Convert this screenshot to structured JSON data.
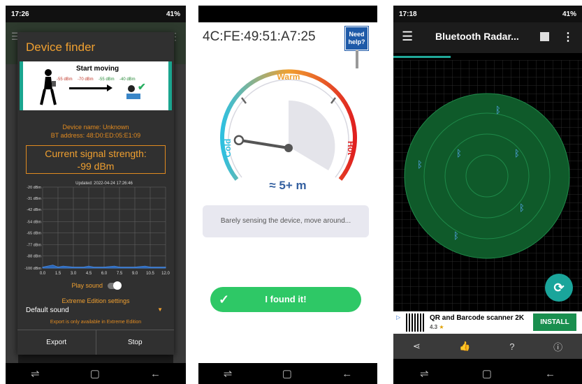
{
  "phone1": {
    "status": {
      "time": "17:26",
      "battery": "41%"
    },
    "dialog_title": "Device finder",
    "banner": {
      "title": "Start moving",
      "dbm": [
        "-55 dBm",
        "-70 dBm",
        "-55 dBm",
        "-40 dBm"
      ]
    },
    "device_name": "Device name: Unknown",
    "bt_address": "BT address: 48:D0:ED:05:E1:09",
    "signal_label": "Current signal strength:",
    "signal_value": "-99 dBm",
    "graph": {
      "updated": "Updated: 2022-04-24 17:26:46",
      "y_ticks": [
        "-20 dBm",
        "-31 dBm",
        "-42 dBm",
        "-54 dBm",
        "-65 dBm",
        "-77 dBm",
        "-88 dBm",
        "-100 dBm"
      ],
      "x_ticks": [
        "0.0",
        "1.5",
        "3.0",
        "4.5",
        "6.0",
        "7.5",
        "9.0",
        "10.5",
        "12.0"
      ],
      "x": [
        0,
        1,
        1.5,
        2,
        3,
        4,
        4.5,
        5,
        6,
        7,
        7.5,
        8,
        9,
        10,
        10.5,
        11,
        12
      ],
      "y": [
        -99,
        -97,
        -99,
        -98,
        -99,
        -99,
        -98,
        -99,
        -99,
        -98,
        -99,
        -99,
        -99,
        -98,
        -99,
        -99,
        -99
      ]
    },
    "play_sound": "Play sound",
    "extreme_settings": "Extreme Edition settings",
    "default_sound": "Default sound",
    "export_note": "Export is only available in Extreme Edition",
    "export_btn": "Export",
    "stop_btn": "Stop"
  },
  "phone2": {
    "mac": "4C:FE:49:51:A7:25",
    "help": "Need help?",
    "warm": "Warm",
    "cold": "Cold",
    "hot": "Hot",
    "needle_fraction": 0.05,
    "distance": "≈ 5+ m",
    "message": "Barely sensing the device, move around...",
    "found_btn": "I found it!"
  },
  "phone3": {
    "status": {
      "time": "17:18",
      "battery": "41%"
    },
    "title": "Bluetooth Radar...",
    "ad": {
      "name": "QR and Barcode scanner 2K",
      "rating": "4.3",
      "install": "INSTALL"
    }
  },
  "colors": {
    "orange": "#f0a030",
    "teal": "#1aa58f",
    "green": "#2ec866",
    "radar": "#0f5a2a"
  }
}
